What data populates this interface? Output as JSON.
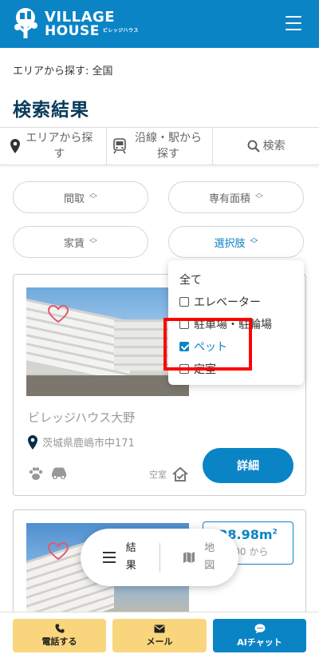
{
  "header": {
    "logo_line1": "VILLAGE",
    "logo_line2": "HOUSE",
    "logo_kana": "ビレッジハウス"
  },
  "breadcrumb": "エリアから探す: 全国",
  "page_title": "検索結果",
  "search_tabs": [
    {
      "label": "エリアから探す",
      "icon": "map-pin-icon"
    },
    {
      "label": "沿線・駅から探す",
      "icon": "train-icon"
    },
    {
      "label": "検索",
      "icon": "search-icon"
    }
  ],
  "filters": {
    "layout": "間取",
    "area": "専有面積",
    "rent": "家賃",
    "options": "選択肢"
  },
  "dropdown": {
    "all": "全て",
    "items": [
      {
        "label": "エレベーター",
        "checked": false
      },
      {
        "label": "駐車場・駐輪場",
        "checked": false
      },
      {
        "label": "ペット",
        "checked": true
      },
      {
        "label": "定室",
        "checked": false
      }
    ]
  },
  "card1": {
    "name": "ビレッジハウス大野",
    "address": "茨城県鹿嶋市中171",
    "vacancy": "空室",
    "detail": "詳細",
    "features": [
      "paw-icon",
      "car-icon"
    ]
  },
  "card2": {
    "area": "28.98m",
    "area_unit": "2",
    "price_from": "800 から"
  },
  "toggle": {
    "results": "結果",
    "map": "地図"
  },
  "bottom": {
    "phone": "電話する",
    "mail": "メール",
    "chat": "AIチャット"
  },
  "colors": {
    "brand": "#0b84c6",
    "cta_yellow": "#f9d67d",
    "highlight": "#ff0000"
  }
}
